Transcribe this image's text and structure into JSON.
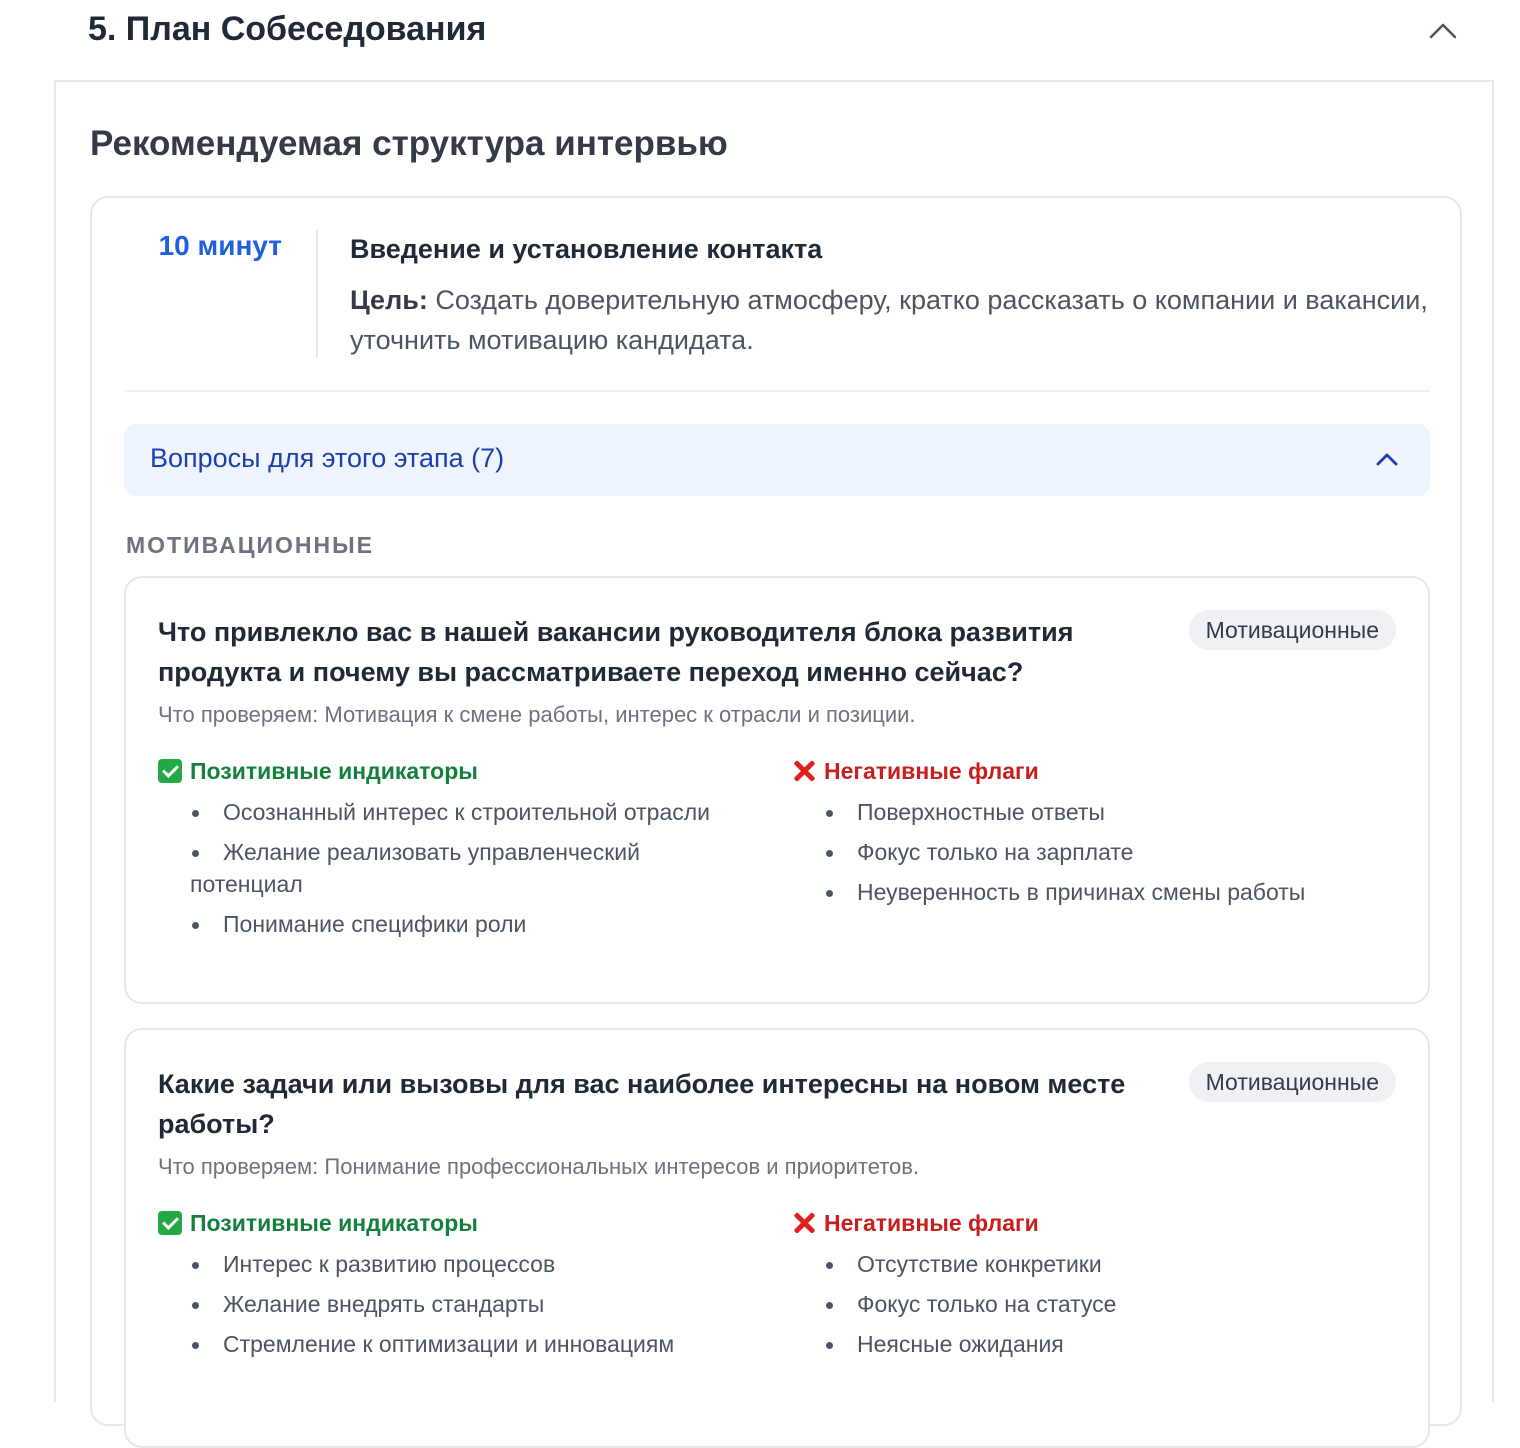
{
  "section": {
    "title": "5. План Собеседования"
  },
  "panel": {
    "title": "Рекомендуемая структура интервью"
  },
  "stage": {
    "time": "10 минут",
    "name": "Введение и установление контакта",
    "goal_label": "Цель:",
    "goal_text": " Создать доверительную атмосферу, кратко рассказать о компании и вакансии, уточнить мотивацию кандидата.",
    "questions_toggle": "Вопросы для этого этапа (7)",
    "category": "МОТИВАЦИОННЫЕ"
  },
  "labels": {
    "check_prefix": "Что проверяем:",
    "positive_heading": "Позитивные индикаторы",
    "negative_heading": "Негативные флаги"
  },
  "questions": [
    {
      "text": "Что привлекло вас в нашей вакансии руководителя блока развития продукта и почему вы рассматриваете переход именно сейчас?",
      "tag": "Мотивационные",
      "check": " Мотивация к смене работы, интерес к отрасли и позиции.",
      "positive": [
        "Осознанный интерес к строительной отрасли",
        "Желание реализовать управленческий потенциал",
        "Понимание специфики роли"
      ],
      "negative": [
        "Поверхностные ответы",
        "Фокус только на зарплате",
        "Неуверенность в причинах смены работы"
      ]
    },
    {
      "text": "Какие задачи или вызовы для вас наиболее интересны на новом месте работы?",
      "tag": "Мотивационные",
      "check": " Понимание профессиональных интересов и приоритетов.",
      "positive": [
        "Интерес к развитию процессов",
        "Желание внедрять стандарты",
        "Стремление к оптимизации и инновациям"
      ],
      "negative": [
        "Отсутствие конкретики",
        "Фокус только на статусе",
        "Неясные ожидания"
      ]
    }
  ],
  "icons": {
    "section_collapse": "chevron-up-icon",
    "questions_collapse": "chevron-up-icon",
    "positive": "check-mark-icon",
    "negative": "cross-mark-icon"
  },
  "colors": {
    "accent_blue": "#1f5fe0",
    "toggle_bg": "#eef5fe",
    "positive": "#15803d",
    "negative": "#c81e1e"
  }
}
